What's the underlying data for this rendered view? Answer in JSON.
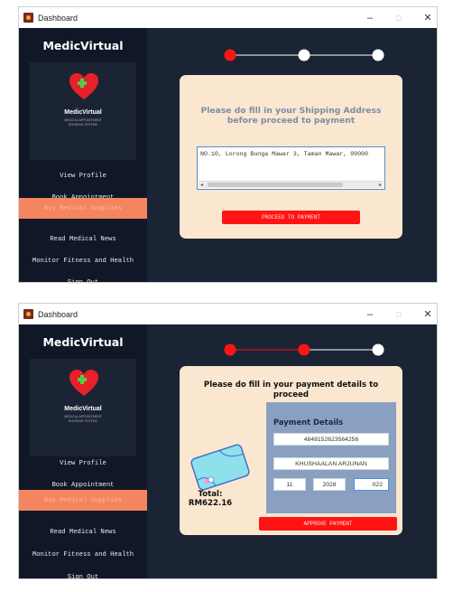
{
  "window": {
    "title": "Dashboard",
    "minimize": "–",
    "maximize": "□",
    "close": "✕"
  },
  "sidebar": {
    "brand": "MedicVirtual",
    "logo_name": "MedicVirtual",
    "logo_sub_1": "MEDICAL APPOINTMENT",
    "logo_sub_2": "BOOKING SYSTEM",
    "items": [
      {
        "label": "View Profile"
      },
      {
        "label": "Book Appointment"
      },
      {
        "label": "Buy Medical Supplies",
        "active": true
      },
      {
        "label": "Read Medical News"
      },
      {
        "label": "Monitor Fitness and Health"
      },
      {
        "label": "Sign Out"
      }
    ]
  },
  "shipping": {
    "prompt_line1": "Please do fill in your Shipping Address",
    "prompt_line2": "before proceed to payment",
    "address": "NO.10, Lorong Bunga Mawar 3, Taman Mawar, 09000",
    "proceed_label": "PROCEED TO PAYMENT",
    "step": 1
  },
  "payment": {
    "prompt_line1": "Please do fill in your payment details to",
    "prompt_line2": "proceed",
    "panel_title": "Payment Details",
    "card_number": "4848152623564256",
    "card_name": "KHUSHAALAN ARJUNAN",
    "exp_month": "11",
    "exp_year": "2028",
    "cvv": "022",
    "total_label": "Total:",
    "total_value": "RM622.16",
    "approve_label": "APPROVE PAYMENT",
    "step": 2
  },
  "colors": {
    "accent_red": "#ff1414",
    "active_menu": "#f4855f",
    "card_bg": "#fbe6cf",
    "panel_bg": "#8aa0c0"
  }
}
